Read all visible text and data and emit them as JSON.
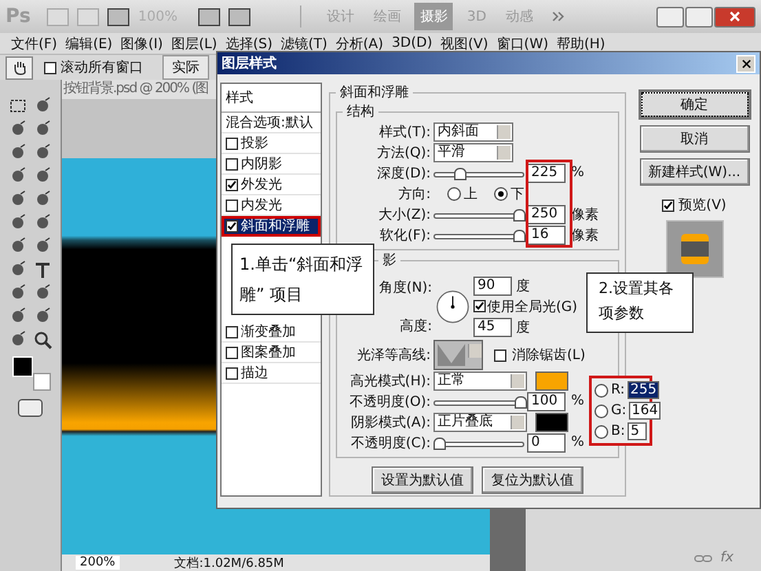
{
  "app": {
    "logo": "Ps",
    "zoom": "100%",
    "workspaces": [
      {
        "label": "设计",
        "selected": false
      },
      {
        "label": "绘画",
        "selected": false
      },
      {
        "label": "摄影",
        "selected": true
      },
      {
        "label": "3D",
        "selected": false
      },
      {
        "label": "动感",
        "selected": false
      }
    ]
  },
  "menu": [
    "文件(F)",
    "编辑(E)",
    "图像(I)",
    "图层(L)",
    "选择(S)",
    "滤镜(T)",
    "分析(A)",
    "3D(D)",
    "视图(V)",
    "窗口(W)",
    "帮助(H)"
  ],
  "options_bar": {
    "scroll_all": {
      "label": "滚动所有窗口",
      "checked": false
    },
    "button": "实际"
  },
  "document": {
    "title": "按钮背景.psd @ 200% (图",
    "zoom": "200%",
    "doc_info": "文档:1.02M/6.85M"
  },
  "layers_panel": {
    "fx": "fx"
  },
  "dialog": {
    "title": "图层样式",
    "styles_header": "样式",
    "blending": "混合选项:默认",
    "styles": [
      {
        "label": "投影",
        "checked": false,
        "selected": false
      },
      {
        "label": "内阴影",
        "checked": false,
        "selected": false
      },
      {
        "label": "外发光",
        "checked": true,
        "selected": false
      },
      {
        "label": "内发光",
        "checked": false,
        "selected": false
      },
      {
        "label": "斜面和浮雕",
        "checked": true,
        "selected": true
      }
    ],
    "styles_lower": [
      {
        "label": "渐变叠加",
        "checked": false,
        "selected": false
      },
      {
        "label": "图案叠加",
        "checked": false,
        "selected": false
      },
      {
        "label": "描边",
        "checked": false,
        "selected": false
      }
    ],
    "bevel": {
      "title": "斜面和浮雕",
      "structure": {
        "title": "结构",
        "style": {
          "label": "样式(T):",
          "value": "内斜面"
        },
        "technique": {
          "label": "方法(Q):",
          "value": "平滑"
        },
        "depth": {
          "label": "深度(D):",
          "level": 0.25,
          "value": "225",
          "unit": "%"
        },
        "direction": {
          "label": "方向:",
          "options": [
            {
              "label": "上",
              "selected": false
            },
            {
              "label": "下",
              "selected": true
            }
          ]
        },
        "size": {
          "label": "大小(Z):",
          "level": 0.98,
          "value": "250",
          "unit": "像素"
        },
        "soften": {
          "label": "软化(F):",
          "level": 0.98,
          "value": "16",
          "unit": "像素"
        }
      },
      "shading": {
        "title": "影",
        "angle": {
          "label": "角度(N):",
          "value": "90",
          "unit": "度"
        },
        "global_light": {
          "label": "使用全局光(G)",
          "checked": true
        },
        "altitude": {
          "label": "高度:",
          "value": "45",
          "unit": "度"
        },
        "gloss": {
          "label": "光泽等高线:"
        },
        "anti_alias": {
          "label": "消除锯齿(L)",
          "checked": false
        },
        "highlight": {
          "label": "高光模式(H):",
          "value": "正常",
          "color": "#f8a400"
        },
        "highlight_opacity": {
          "label": "不透明度(O):",
          "level": 1,
          "value": "100",
          "unit": "%"
        },
        "shadow": {
          "label": "阴影模式(A):",
          "value": "正片叠底",
          "color": "#000000"
        },
        "shadow_opacity": {
          "label": "不透明度(C):",
          "level": 0,
          "value": "0",
          "unit": "%"
        }
      },
      "buttons": [
        "设置为默认值",
        "复位为默认值"
      ]
    },
    "side_buttons": [
      "确定",
      "取消",
      "新建样式(W)..."
    ],
    "preview": {
      "label": "预览(V)",
      "checked": true
    }
  },
  "color_fields": [
    {
      "label": "R:",
      "value": "255",
      "selected": false,
      "highlighted": true
    },
    {
      "label": "G:",
      "value": "164",
      "selected": false,
      "highlighted": false
    },
    {
      "label": "B:",
      "value": "5",
      "selected": false,
      "highlighted": false
    }
  ],
  "callouts": [
    "1.单击“斜面和浮雕” 项目",
    "2.设置其各项参数"
  ]
}
